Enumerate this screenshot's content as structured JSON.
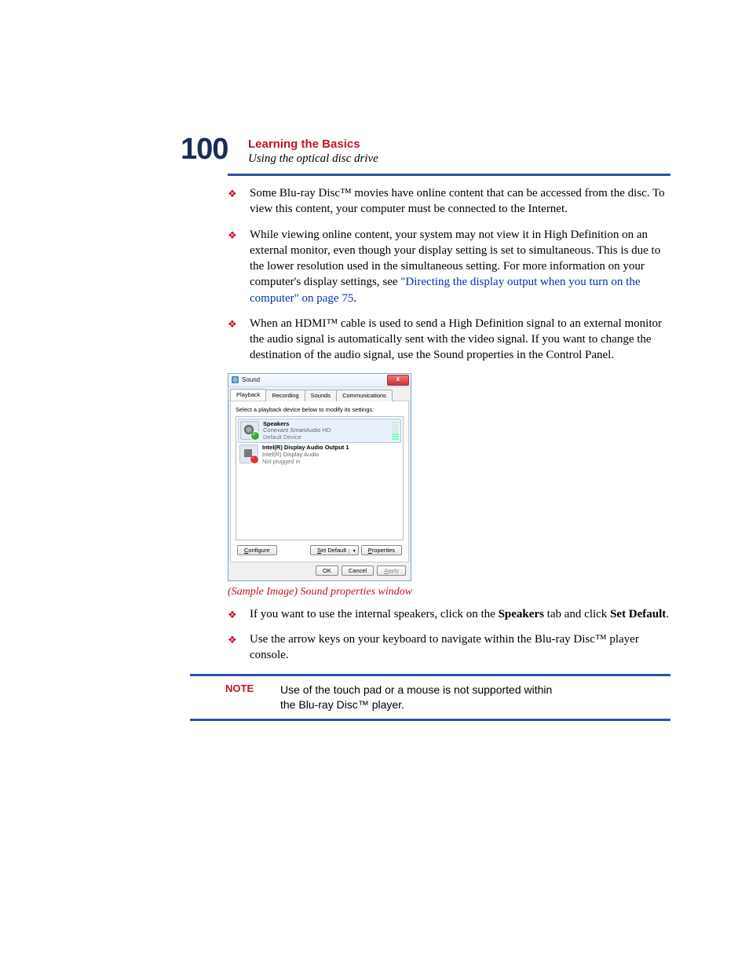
{
  "header": {
    "page_number": "100",
    "section_title": "Learning the Basics",
    "section_subtitle": "Using the optical disc drive"
  },
  "bullets_top": [
    {
      "text": "Some Blu-ray Disc™ movies have online content that can be accessed from the disc. To view this content, your computer must be connected to the Internet."
    },
    {
      "text_part1": "While viewing online content, your system may not view it in High Definition on an external monitor, even though your display setting is set to simultaneous. This is due to the lower resolution used in the simultaneous setting. For more information on your computer's display settings, see ",
      "link": "\"Directing the display output when you turn on the computer\" on page 75",
      "text_part2": "."
    },
    {
      "text": "When an HDMI™ cable is used to send a High Definition signal to an external monitor the audio signal is automatically sent with the video signal. If you want to change the destination of the audio signal, use the Sound properties in the Control Panel."
    }
  ],
  "caption": "(Sample Image) Sound properties window",
  "bullets_bottom": [
    {
      "text_pre": "If you want to use the internal speakers, click on the ",
      "bold1": "Speakers",
      "text_mid": " tab and click ",
      "bold2": "Set Default",
      "text_post": "."
    },
    {
      "text": "Use the arrow keys on your keyboard to navigate within the Blu-ray Disc™ player console."
    }
  ],
  "note": {
    "label": "NOTE",
    "text": "Use of the touch pad or a mouse is not supported within the Blu-ray Disc™ player."
  },
  "dialog": {
    "title": "Sound",
    "close": "x",
    "tabs": {
      "playback": "Playback",
      "recording": "Recording",
      "sounds": "Sounds",
      "communications": "Communications"
    },
    "instruction": "Select a playback device below to modify its settings:",
    "device1": {
      "name": "Speakers",
      "desc": "Conexant SmartAudio HD",
      "status": "Default Device"
    },
    "device2": {
      "name": "Intel(R) Display Audio Output 1",
      "desc": "Intel(R) Display Audio",
      "status": "Not plugged in"
    },
    "buttons": {
      "configure": "Configure",
      "set_default": "Set Default",
      "properties": "Properties",
      "ok": "OK",
      "cancel": "Cancel",
      "apply": "Apply"
    }
  }
}
